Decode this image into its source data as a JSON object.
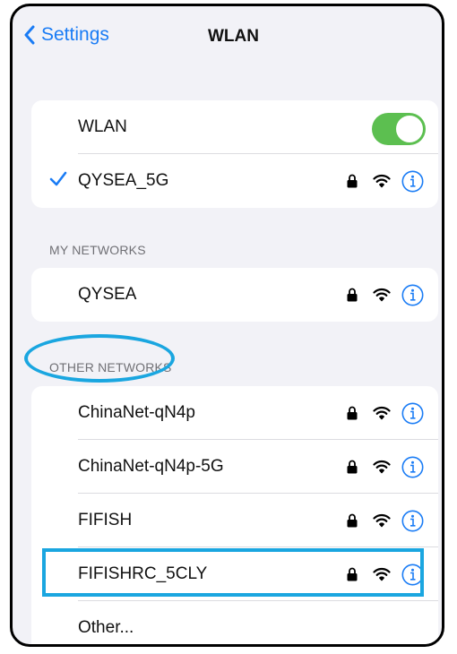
{
  "navbar": {
    "back_label": "Settings",
    "title": "WLAN"
  },
  "wlan_group": {
    "toggle_label": "WLAN",
    "toggle_on": true,
    "connected_network": "QYSEA_5G"
  },
  "my_networks": {
    "header": "MY NETWORKS",
    "items": [
      {
        "name": "QYSEA"
      }
    ]
  },
  "other_networks": {
    "header": "OTHER NETWORKS",
    "items": [
      {
        "name": "ChinaNet-qN4p"
      },
      {
        "name": "ChinaNet-qN4p-5G"
      },
      {
        "name": "FIFISH"
      },
      {
        "name": "FIFISHRC_5CLY"
      }
    ],
    "other_label": "Other..."
  },
  "icons": {
    "lock": "lock-icon",
    "wifi": "wifi-icon",
    "info": "info-icon",
    "check": "checkmark-icon",
    "back": "chevron-left-icon"
  },
  "colors": {
    "accent": "#1a7cf5",
    "toggle_on": "#5cbf50",
    "annotation": "#1aa6e0"
  }
}
